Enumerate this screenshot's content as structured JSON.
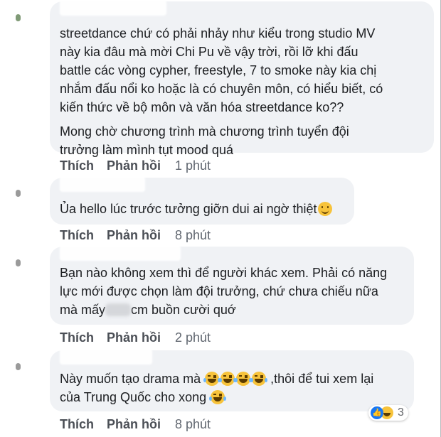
{
  "comments": [
    {
      "lines": [
        "streetdance chứ có phải nhảy như kiểu trong studio MV",
        "này kia đâu mà mời Chi Pu về vậy trời, rồi lỡ khi đấu",
        "battle các vòng cypher, freestyle, 7 to smoke này kia chị",
        "nhắm đấu nổi ko hoặc là có chuyên môn, có hiểu biết, có",
        "kiến thức về bộ môn và văn hóa streetdance ko??"
      ],
      "lines2": [
        "Mong chờ chương trình mà chương trình tuyển đội",
        "trưởng làm mình tụt mood quá"
      ],
      "like_label": "Thích",
      "reply_label": "Phản hồi",
      "time": "1 phút"
    },
    {
      "text": "Ủa hello lúc trước tưởng giỡn dui ai ngờ thiệt",
      "emoji": "smile-emoji",
      "like_label": "Thích",
      "reply_label": "Phản hồi",
      "time": "8 phút"
    },
    {
      "line1": "Bạn nào không xem thì để người khác xem. Phải có năng",
      "line2": "lực mới được chọn làm đội trưởng, chứ chưa chiếu nữa",
      "line3_pre": "mà mấy",
      "line3_post": "cm buồn cười quớ",
      "like_label": "Thích",
      "reply_label": "Phản hồi",
      "time": "2 phút"
    },
    {
      "line1_pre": "Này muốn tạo drama mà",
      "line1_post": ",thôi để tui xem lại",
      "line2": "của Trung Quốc cho xong",
      "emoji": "laugh-cry-emoji",
      "reaction_count": "3",
      "like_label": "Thích",
      "reply_label": "Phản hồi",
      "time": "8 phút"
    }
  ],
  "colors": {
    "bubble": "#f0f2f5",
    "action_text": "#4b4f56",
    "time_text": "#616770",
    "like_blue": "#1877f2"
  }
}
